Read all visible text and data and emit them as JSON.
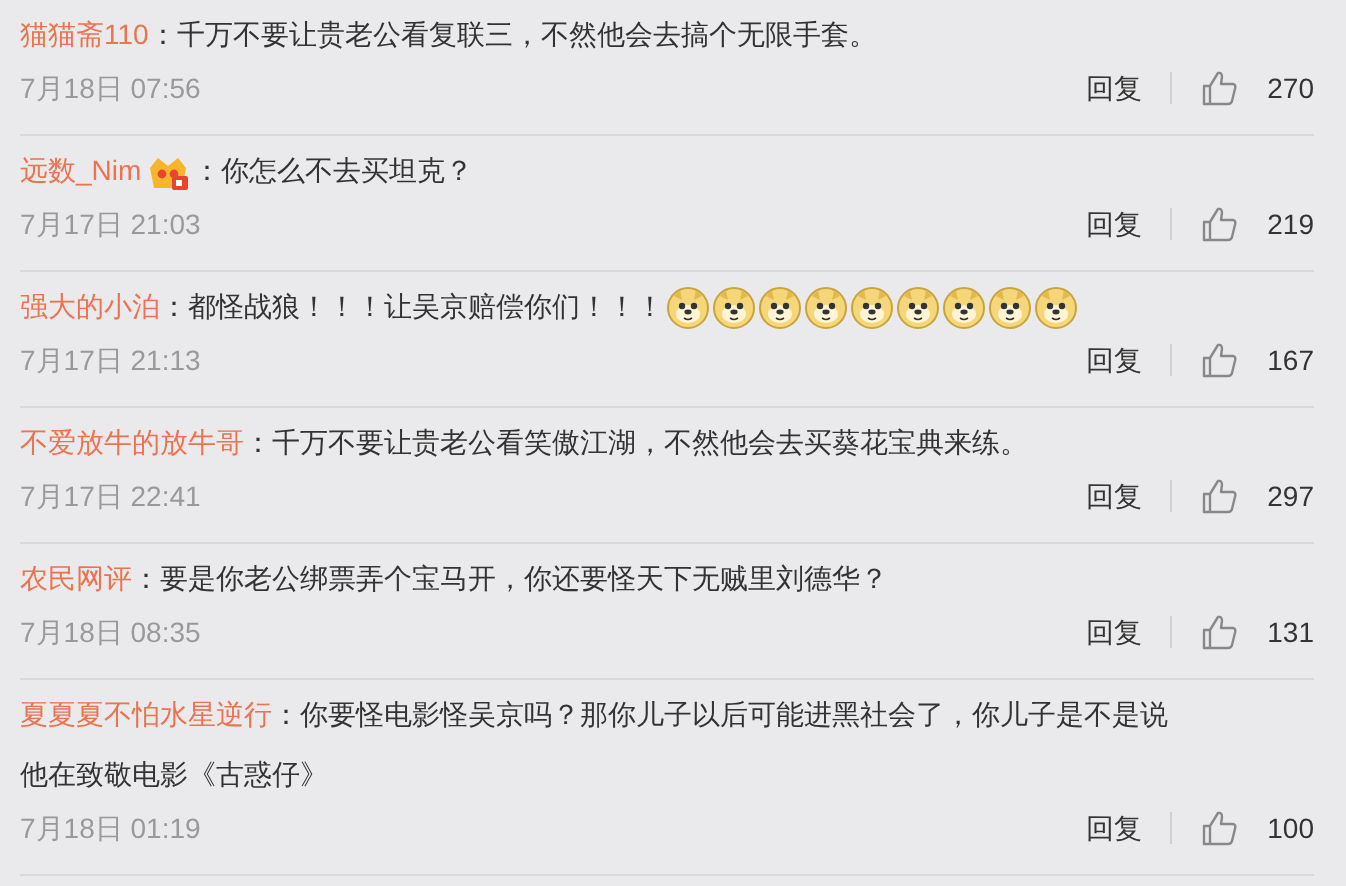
{
  "comments": [
    {
      "user": "猫猫斋110",
      "badge": false,
      "text": "：千万不要让贵老公看复联三，不然他会去搞个无限手套。",
      "time": "7月18日 07:56",
      "reply": "回复",
      "likes": "270"
    },
    {
      "user": "远数_Nim",
      "badge": true,
      "text": "：你怎么不去买坦克？",
      "time": "7月17日 21:03",
      "reply": "回复",
      "likes": "219"
    },
    {
      "user": "强大的小泊",
      "badge": false,
      "text": "：都怪战狼！！！让吴京赔偿你们！！！",
      "emojis": [
        {
          "kind": "doge"
        },
        {
          "kind": "doge"
        },
        {
          "kind": "doge"
        },
        {
          "kind": "doge"
        },
        {
          "kind": "doge"
        },
        {
          "kind": "doge"
        },
        {
          "kind": "doge"
        },
        {
          "kind": "doge"
        },
        {
          "kind": "doge"
        }
      ],
      "time": "7月17日 21:13",
      "reply": "回复",
      "likes": "167"
    },
    {
      "user": "不爱放牛的放牛哥",
      "badge": false,
      "text": "：千万不要让贵老公看笑傲江湖，不然他会去买葵花宝典来练。",
      "time": "7月17日 22:41",
      "reply": "回复",
      "likes": "297"
    },
    {
      "user": "农民网评",
      "badge": false,
      "text": "：要是你老公绑票弄个宝马开，你还要怪天下无贼里刘德华？",
      "time": "7月18日 08:35",
      "reply": "回复",
      "likes": "131"
    },
    {
      "user": "夏夏夏不怕水星逆行",
      "badge": false,
      "text": "：你要怪电影怪吴京吗？那你儿子以后可能进黑社会了，你儿子是不是说他在致敬电影《古惑仔》",
      "time": "7月18日 01:19",
      "reply": "回复",
      "likes": "100"
    }
  ]
}
